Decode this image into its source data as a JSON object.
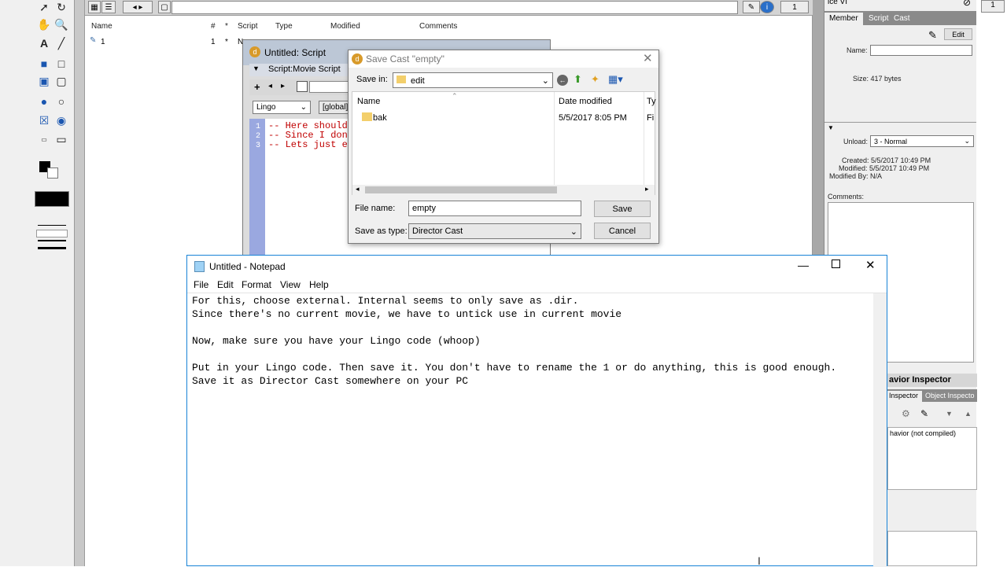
{
  "cast_window": {
    "columns": [
      "Name",
      "#",
      "*",
      "Script",
      "Type",
      "Modified",
      "Comments"
    ],
    "page_value": "1",
    "rows": [
      {
        "name": "1",
        "number": "1",
        "star": "*",
        "script": "N"
      }
    ]
  },
  "script_window": {
    "title": "Untitled: Script",
    "subtitle": "Script:Movie Script",
    "language": "Lingo",
    "scope": "[global]",
    "lines": [
      {
        "num": "1",
        "text": "-- Here should"
      },
      {
        "num": "2",
        "text": "-- Since I don"
      },
      {
        "num": "3",
        "text": "-- Lets just e"
      }
    ]
  },
  "save_dialog": {
    "title": "Save Cast \"empty\"",
    "save_in_label": "Save in:",
    "save_in_value": "edit",
    "col_name": "Name",
    "col_date": "Date modified",
    "col_type": "Ty",
    "files": [
      {
        "name": "bak",
        "date": "5/5/2017 8:05 PM",
        "type": "Fi"
      }
    ],
    "file_name_label": "File name:",
    "file_name_value": "empty",
    "save_type_label": "Save as type:",
    "save_type_value": "Director Cast",
    "save_button": "Save",
    "cancel_button": "Cancel"
  },
  "property_inspector": {
    "header": "ice VI",
    "tabs": [
      "Member",
      "Script",
      "Cast"
    ],
    "edit_button": "Edit",
    "name_label": "Name:",
    "size": "Size: 417 bytes",
    "unload_label": "Unload:",
    "unload_value": "3 - Normal",
    "created": "Created: 5/5/2017 10:49 PM",
    "modified": "Modified: 5/5/2017 10:49 PM",
    "modified_by": "Modified By: N/A",
    "comments_label": "Comments:",
    "page_value": "1"
  },
  "behavior_inspector": {
    "title": "avior Inspector",
    "tab_1": "Inspector",
    "tab_2": "Object Inspecto",
    "status": "havior (not compiled)"
  },
  "notepad": {
    "title": "Untitled - Notepad",
    "menus": [
      "File",
      "Edit",
      "Format",
      "View",
      "Help"
    ],
    "text": "For this, choose external. Internal seems to only save as .dir.\nSince there's no current movie, we have to untick use in current movie\n\nNow, make sure you have your Lingo code (whoop)\n\nPut in your Lingo code. Then save it. You don't have to rename the 1 or do anything, this is good enough.\nSave it as Director Cast somewhere on your PC"
  }
}
